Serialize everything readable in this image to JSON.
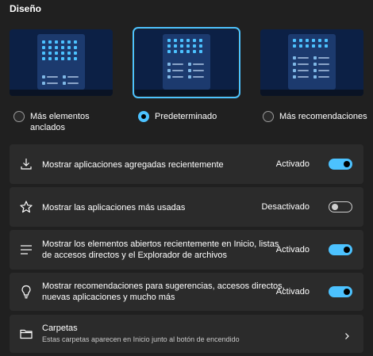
{
  "section": {
    "title": "Diseño"
  },
  "layout_options": [
    {
      "label_line1": "Más elementos",
      "label_line2": "anclados",
      "selected": false
    },
    {
      "label_line1": "Predeterminado",
      "label_line2": "",
      "selected": true
    },
    {
      "label_line1": "Más recomendaciones",
      "label_line2": "",
      "selected": false
    }
  ],
  "settings": [
    {
      "icon": "download-icon",
      "label_line1": "Mostrar aplicaciones agregadas recientemente",
      "label_line2": "",
      "status": "Activado",
      "toggle_on": true
    },
    {
      "icon": "star-icon",
      "label_line1": "Mostrar las aplicaciones más usadas",
      "label_line2": "",
      "status": "Desactivado",
      "toggle_on": false
    },
    {
      "icon": "list-icon",
      "label_line1": "Mostrar los elementos abiertos recientemente en Inicio, listas",
      "label_line2": "de accesos directos y el Explorador de archivos",
      "status": "Activado",
      "toggle_on": true
    },
    {
      "icon": "lightbulb-icon",
      "label_line1": "Mostrar recomendaciones para sugerencias, accesos directos,",
      "label_line2": "nuevas aplicaciones y mucho más",
      "status": "Activado",
      "toggle_on": true
    }
  ],
  "folders": {
    "icon": "folder-icon",
    "title": "Carpetas",
    "subtitle": "Estas carpetas aparecen en Inicio junto al botón de encendido"
  },
  "colors": {
    "accent": "#4cc2ff",
    "background": "#202020",
    "card": "#2b2b2b",
    "preview_bg": "#0c2045"
  }
}
